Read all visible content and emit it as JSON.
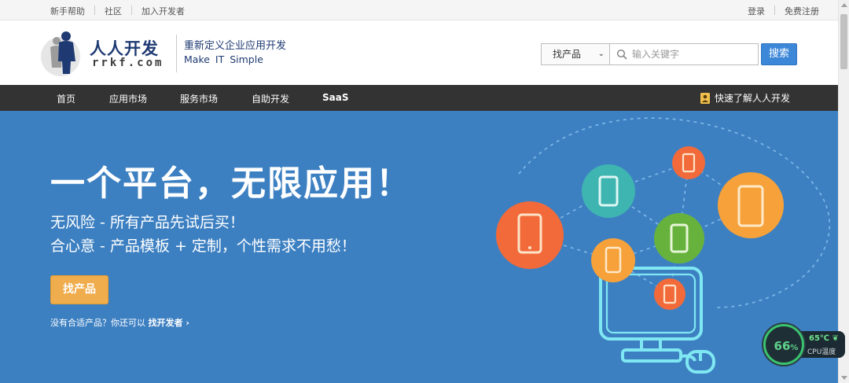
{
  "topbar": {
    "left_links": [
      "新手帮助",
      "社区",
      "加入开发者"
    ],
    "right_links": [
      "登录",
      "免费注册"
    ]
  },
  "header": {
    "logo_cn": "人人开发",
    "logo_en": "rrkf.com",
    "slogan_line1": "重新定义企业应用开发",
    "slogan_line2": "Make IT Simple",
    "search_select": "找产品",
    "search_placeholder": "输入关键字",
    "search_button": "搜索"
  },
  "nav": {
    "items": [
      "首页",
      "应用市场",
      "服务市场",
      "自助开发",
      "SaaS"
    ],
    "quick_link": "快速了解人人开发"
  },
  "hero": {
    "title": "一个平台，无限应用！",
    "line1": "无风险  -  所有产品先试后买！",
    "line2": "合心意  -  产品模板 + 定制，个性需求不用愁！",
    "button": "找产品",
    "hint_prefix": "没有合适产品？你还可以",
    "hint_link": "找开发者",
    "hint_arrow": "›"
  },
  "cpu_widget": {
    "percent": "66",
    "percent_unit": "%",
    "temperature": "65℃",
    "label": "CPU温度"
  },
  "colors": {
    "hero_bg": "#3d80c2",
    "nav_bg": "#333333",
    "primary_button": "#3d87d8",
    "accent_button": "#f0ad4e",
    "brand_text": "#1f3a73"
  }
}
